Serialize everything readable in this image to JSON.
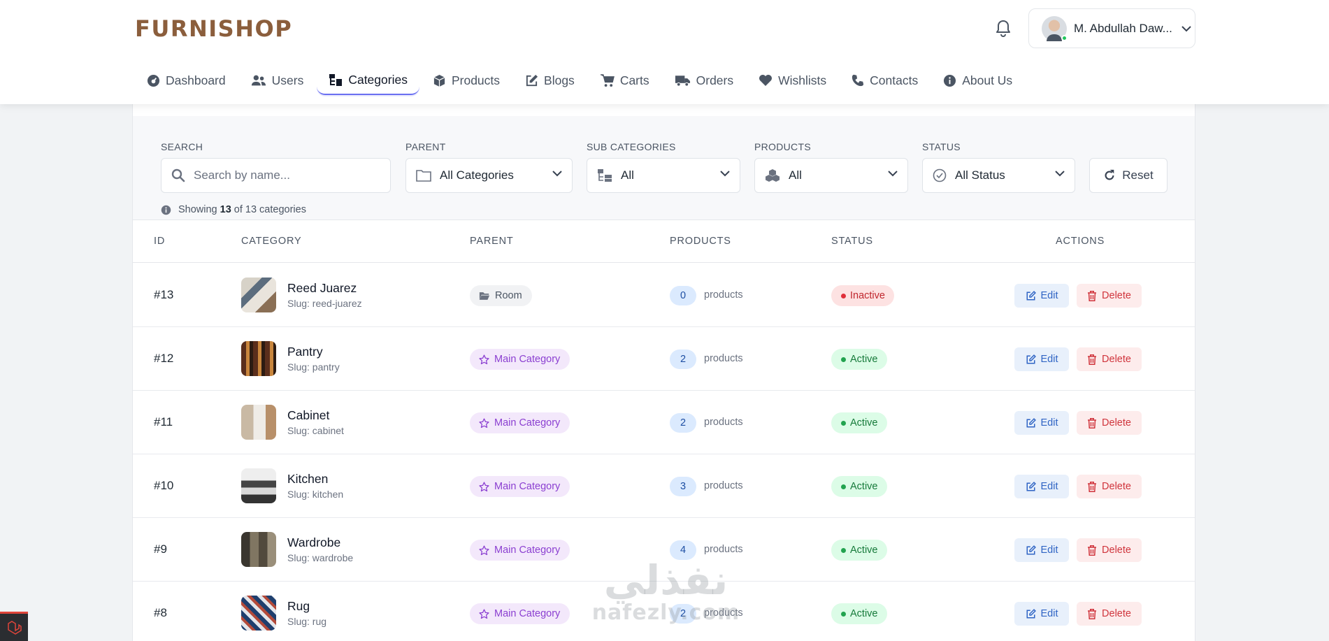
{
  "brand": {
    "name": "FURNISHOP",
    "color": "#8b5e3c"
  },
  "user": {
    "name": "M. Abdullah Daw...",
    "online": true
  },
  "nav": [
    {
      "label": "Dashboard",
      "icon": "dashboard-icon"
    },
    {
      "label": "Users",
      "icon": "users-icon"
    },
    {
      "label": "Categories",
      "icon": "categories-icon",
      "active": true
    },
    {
      "label": "Products",
      "icon": "box-icon"
    },
    {
      "label": "Blogs",
      "icon": "edit-icon"
    },
    {
      "label": "Carts",
      "icon": "cart-icon"
    },
    {
      "label": "Orders",
      "icon": "truck-icon"
    },
    {
      "label": "Wishlists",
      "icon": "heart-icon"
    },
    {
      "label": "Contacts",
      "icon": "phone-icon"
    },
    {
      "label": "About Us",
      "icon": "info-icon"
    }
  ],
  "filters": {
    "search": {
      "label": "SEARCH",
      "placeholder": "Search by name..."
    },
    "parent": {
      "label": "PARENT",
      "value": "All Categories"
    },
    "sub_categories": {
      "label": "SUB CATEGORIES",
      "value": "All"
    },
    "products": {
      "label": "PRODUCTS",
      "value": "All"
    },
    "status": {
      "label": "STATUS",
      "value": "All Status"
    },
    "reset_label": "Reset",
    "showing": {
      "prefix": "Showing",
      "shown": "13",
      "middle": "of 13 categories"
    }
  },
  "table": {
    "headers": {
      "id": "ID",
      "category": "CATEGORY",
      "parent": "PARENT",
      "products": "PRODUCTS",
      "status": "STATUS",
      "actions": "ACTIONS"
    },
    "products_suffix": "products",
    "edit_label": "Edit",
    "delete_label": "Delete",
    "rows": [
      {
        "id": "#13",
        "name": "Reed Juarez",
        "slug": "Slug: reed-juarez",
        "parent": "Room",
        "parent_type": "room",
        "products": "0",
        "status": "Inactive"
      },
      {
        "id": "#12",
        "name": "Pantry",
        "slug": "Slug: pantry",
        "parent": "Main Category",
        "parent_type": "main",
        "products": "2",
        "status": "Active"
      },
      {
        "id": "#11",
        "name": "Cabinet",
        "slug": "Slug: cabinet",
        "parent": "Main Category",
        "parent_type": "main",
        "products": "2",
        "status": "Active"
      },
      {
        "id": "#10",
        "name": "Kitchen",
        "slug": "Slug: kitchen",
        "parent": "Main Category",
        "parent_type": "main",
        "products": "3",
        "status": "Active"
      },
      {
        "id": "#9",
        "name": "Wardrobe",
        "slug": "Slug: wardrobe",
        "parent": "Main Category",
        "parent_type": "main",
        "products": "4",
        "status": "Active"
      },
      {
        "id": "#8",
        "name": "Rug",
        "slug": "Slug: rug",
        "parent": "Main Category",
        "parent_type": "main",
        "products": "2",
        "status": "Active"
      }
    ]
  },
  "watermark": {
    "arabic": "نفذلي",
    "latin": "nafezly.com"
  },
  "colors": {
    "accent": "#6a6ff1",
    "active": "#22a34f",
    "inactive": "#e02f3a",
    "main_category": "#8b3fd1"
  }
}
